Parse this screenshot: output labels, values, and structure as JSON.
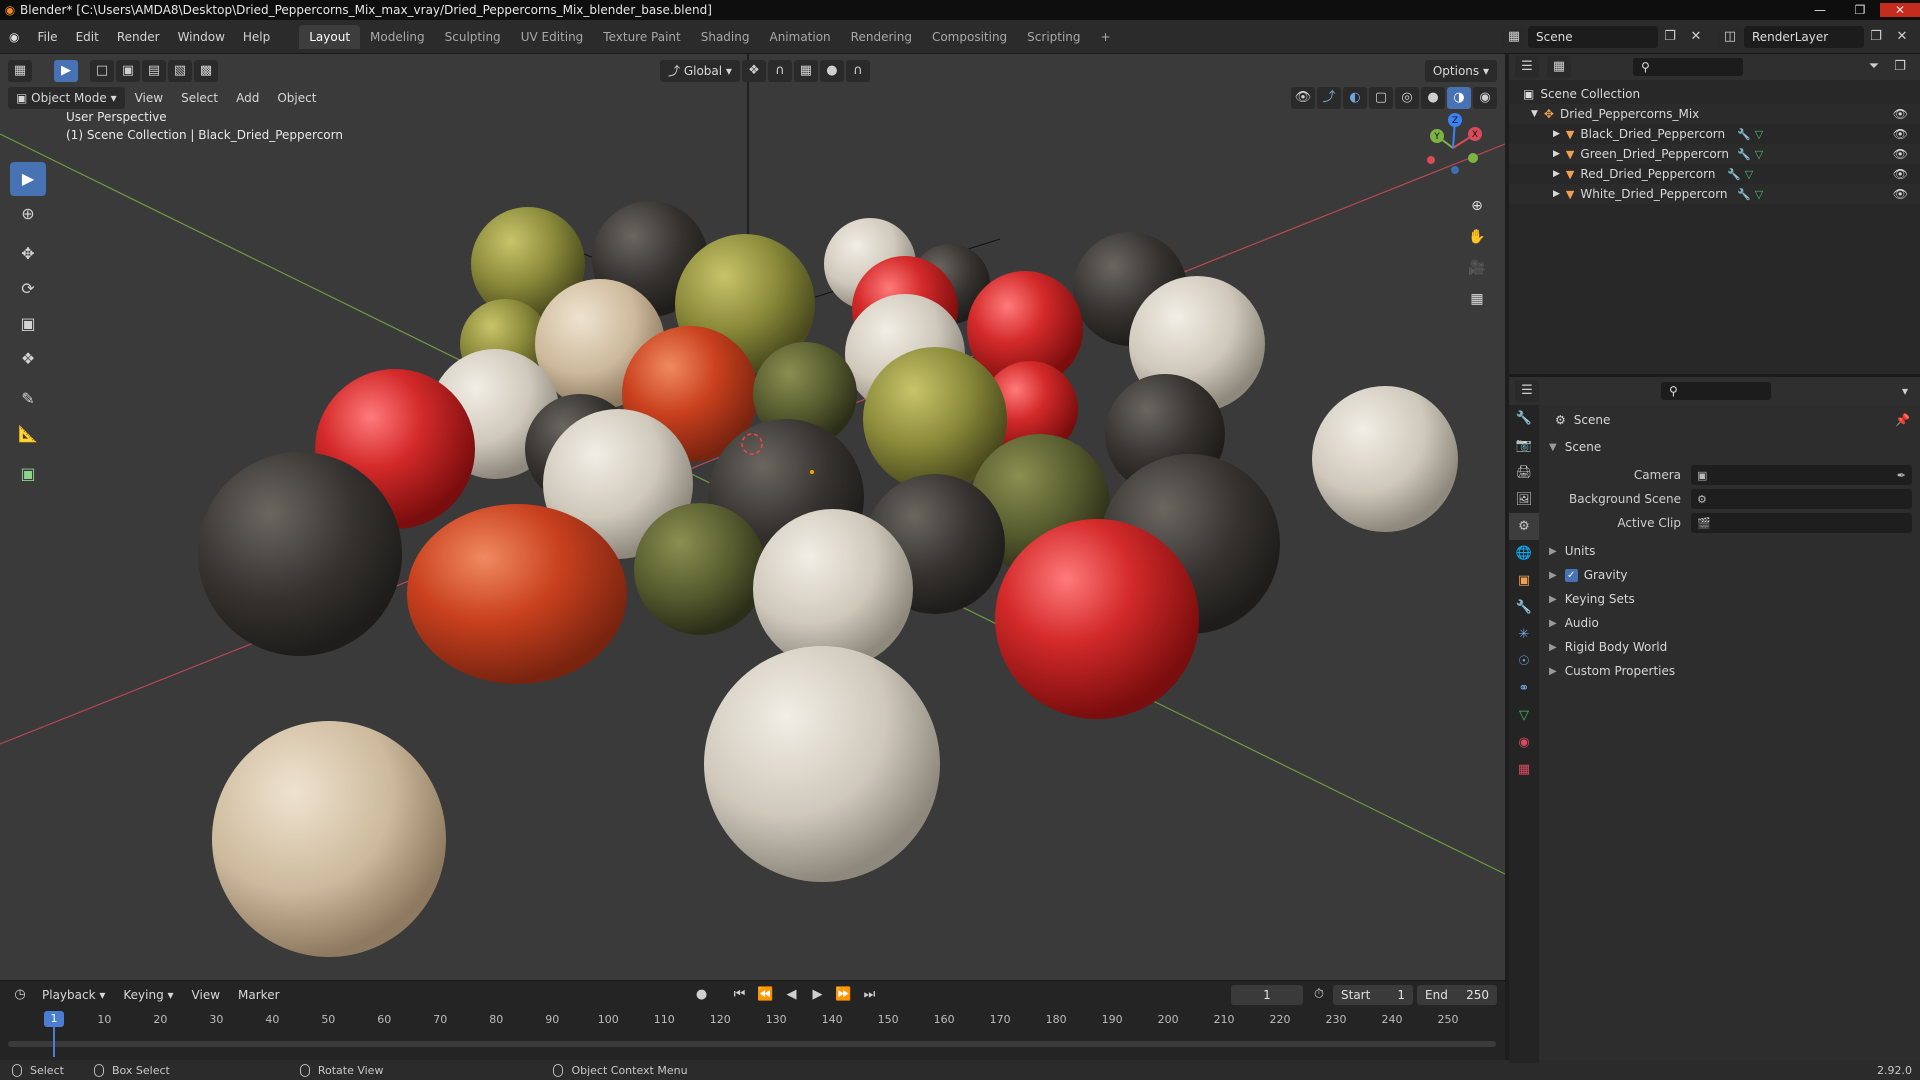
{
  "titlebar": {
    "title": "Blender* [C:\\Users\\AMDA8\\Desktop\\Dried_Peppercorns_Mix_max_vray/Dried_Peppercorns_Mix_blender_base.blend]"
  },
  "menus": [
    "File",
    "Edit",
    "Render",
    "Window",
    "Help"
  ],
  "workspaces": [
    "Layout",
    "Modeling",
    "Sculpting",
    "UV Editing",
    "Texture Paint",
    "Shading",
    "Animation",
    "Rendering",
    "Compositing",
    "Scripting"
  ],
  "active_workspace": "Layout",
  "scene_name": "Scene",
  "view_layer": "RenderLayer",
  "viewport": {
    "transform_orientation": "Global",
    "options_label": "Options",
    "mode": "Object Mode",
    "menus": [
      "View",
      "Select",
      "Add",
      "Object"
    ],
    "overlay_line1": "User Perspective",
    "overlay_line2": "(1) Scene Collection | Black_Dried_Peppercorn",
    "gizmo": {
      "x": "X",
      "y": "Y",
      "z": "Z"
    }
  },
  "timeline": {
    "menus": [
      "Playback",
      "Keying",
      "View",
      "Marker"
    ],
    "current_frame": "1",
    "start_label": "Start",
    "start_value": "1",
    "end_label": "End",
    "end_value": "250",
    "ticks": [
      "1",
      "10",
      "20",
      "30",
      "40",
      "50",
      "60",
      "70",
      "80",
      "90",
      "100",
      "110",
      "120",
      "130",
      "140",
      "150",
      "160",
      "170",
      "180",
      "190",
      "200",
      "210",
      "220",
      "230",
      "240",
      "250"
    ]
  },
  "statusbar": {
    "select": "Select",
    "box_select": "Box Select",
    "rotate_view": "Rotate View",
    "context_menu": "Object Context Menu",
    "version": "2.92.0"
  },
  "outliner": {
    "root": "Scene Collection",
    "collection": "Dried_Peppercorns_Mix",
    "objects": [
      "Black_Dried_Peppercorn",
      "Green_Dried_Peppercorn",
      "Red_Dried_Peppercorn",
      "White_Dried_Peppercorn"
    ]
  },
  "properties": {
    "header": "Scene",
    "panel_title": "Scene",
    "camera_label": "Camera",
    "bg_scene_label": "Background Scene",
    "active_clip_label": "Active Clip",
    "sections": [
      "Units",
      "Gravity",
      "Keying Sets",
      "Audio",
      "Rigid Body World",
      "Custom Properties"
    ]
  },
  "colors": {
    "accent": "#4772b3",
    "x_axis": "#d94a5a",
    "y_axis": "#7cb342",
    "z_axis": "#3b82f6"
  }
}
